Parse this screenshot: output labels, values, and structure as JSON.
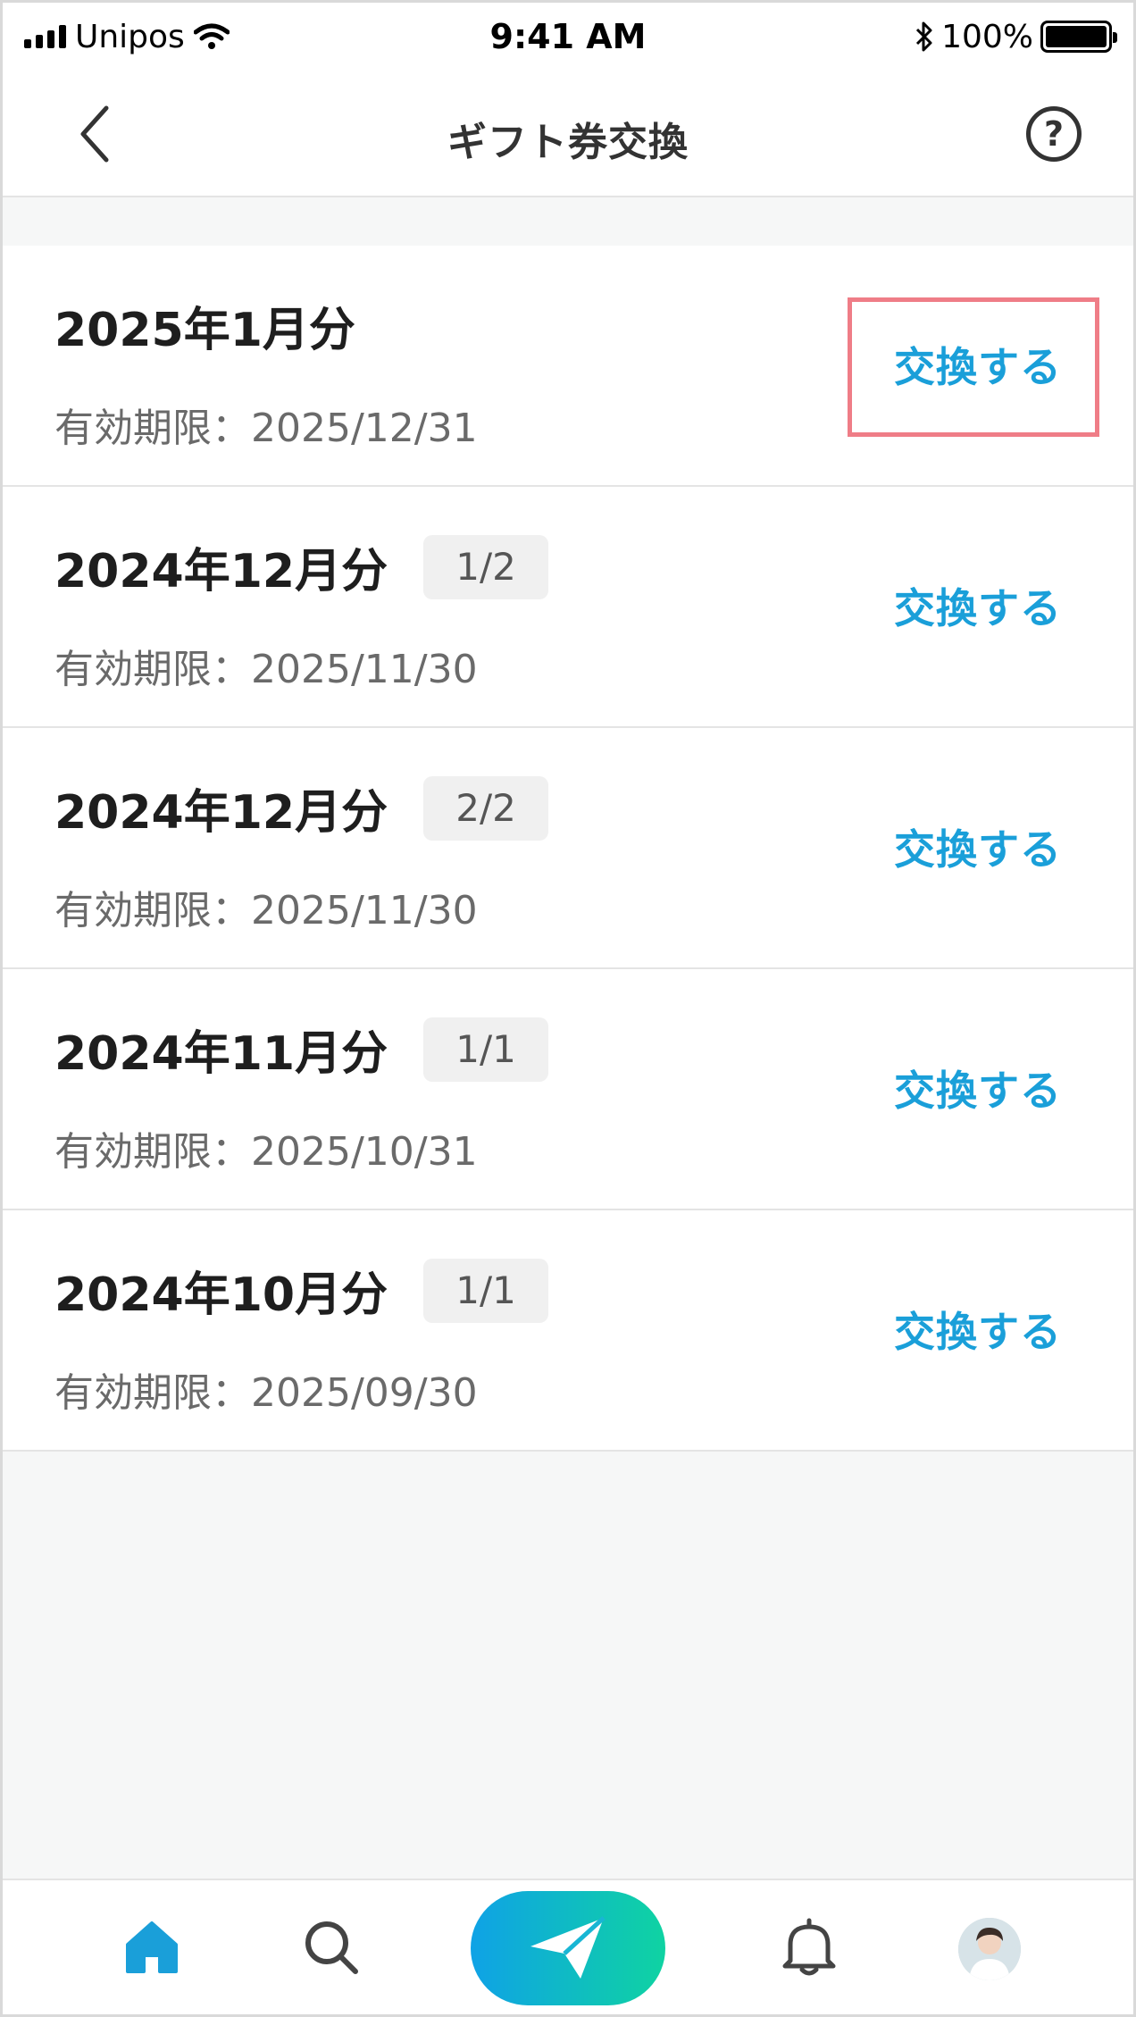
{
  "status_bar": {
    "carrier": "Unipos",
    "time": "9:41 AM",
    "battery": "100%"
  },
  "header": {
    "title": "ギフト券交換",
    "help_label": "?"
  },
  "items": [
    {
      "title": "2025年1月分",
      "badge": "",
      "expiry": "有効期限：2025/12/31",
      "action": "交換する"
    },
    {
      "title": "2024年12月分",
      "badge": "1/2",
      "expiry": "有効期限：2025/11/30",
      "action": "交換する"
    },
    {
      "title": "2024年12月分",
      "badge": "2/2",
      "expiry": "有効期限：2025/11/30",
      "action": "交換する"
    },
    {
      "title": "2024年11月分",
      "badge": "1/1",
      "expiry": "有効期限：2025/10/31",
      "action": "交換する"
    },
    {
      "title": "2024年10月分",
      "badge": "1/1",
      "expiry": "有効期限：2025/09/30",
      "action": "交換する"
    }
  ],
  "colors": {
    "accent": "#1a9fd9",
    "highlight": "#ef7d87",
    "send_gradient_start": "#0fa2e6",
    "send_gradient_end": "#0fd3a2"
  },
  "bottom_nav": {
    "icons": [
      "home-icon",
      "search-icon",
      "send-icon",
      "bell-icon",
      "avatar"
    ]
  }
}
